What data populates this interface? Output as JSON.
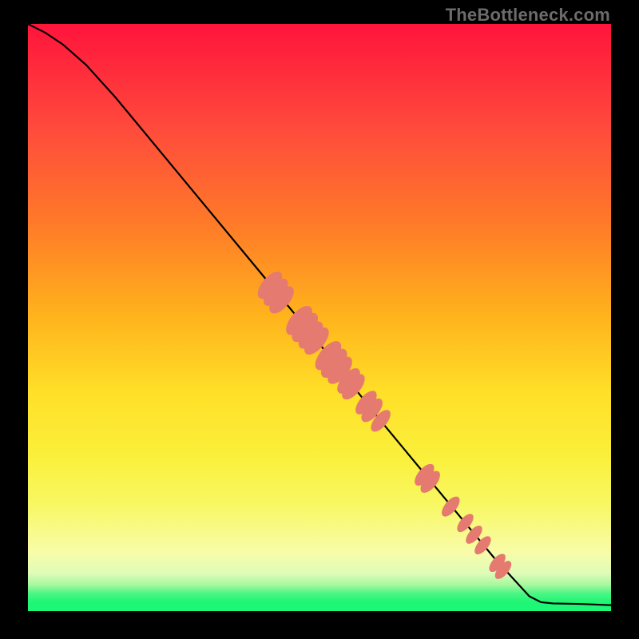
{
  "watermark": "TheBottleneck.com",
  "colors": {
    "gradient_top": "#ff143c",
    "gradient_mid_upper": "#ff7a28",
    "gradient_mid": "#ffe028",
    "gradient_lower": "#f8fca8",
    "gradient_bottom": "#1ef676",
    "frame": "#000000",
    "curve": "#000000",
    "points": "#e57a70"
  },
  "chart_data": {
    "type": "line",
    "title": "",
    "xlabel": "",
    "ylabel": "",
    "xlim": [
      0,
      100
    ],
    "ylim": [
      0,
      100
    ],
    "note": "Axes are unlabeled; values are estimated on a 0–100 grid from the plot geometry. Large y = top (red), small y = bottom (green).",
    "curve": [
      {
        "x": 0.0,
        "y": 100.0
      },
      {
        "x": 3.0,
        "y": 98.5
      },
      {
        "x": 6.0,
        "y": 96.5
      },
      {
        "x": 10.0,
        "y": 93.0
      },
      {
        "x": 15.0,
        "y": 87.5
      },
      {
        "x": 20.0,
        "y": 81.5
      },
      {
        "x": 30.0,
        "y": 69.5
      },
      {
        "x": 40.0,
        "y": 57.5
      },
      {
        "x": 50.0,
        "y": 45.5
      },
      {
        "x": 60.0,
        "y": 33.0
      },
      {
        "x": 70.0,
        "y": 21.0
      },
      {
        "x": 80.0,
        "y": 9.0
      },
      {
        "x": 86.0,
        "y": 2.5
      },
      {
        "x": 88.0,
        "y": 1.5
      },
      {
        "x": 90.0,
        "y": 1.3
      },
      {
        "x": 95.0,
        "y": 1.2
      },
      {
        "x": 100.0,
        "y": 1.0
      }
    ],
    "points_cluster_1": [
      {
        "x": 41.5,
        "y": 55.5,
        "w": 3.0
      },
      {
        "x": 42.5,
        "y": 54.3,
        "w": 3.0
      },
      {
        "x": 43.5,
        "y": 53.0,
        "w": 3.0
      },
      {
        "x": 46.5,
        "y": 49.5,
        "w": 3.2
      },
      {
        "x": 47.5,
        "y": 48.3,
        "w": 3.2
      },
      {
        "x": 48.5,
        "y": 47.0,
        "w": 3.0
      },
      {
        "x": 49.5,
        "y": 46.0,
        "w": 3.0
      },
      {
        "x": 51.5,
        "y": 43.5,
        "w": 3.2
      },
      {
        "x": 52.5,
        "y": 42.2,
        "w": 3.2
      },
      {
        "x": 53.5,
        "y": 41.0,
        "w": 3.0
      },
      {
        "x": 55.0,
        "y": 39.2,
        "w": 2.8
      },
      {
        "x": 55.8,
        "y": 38.2,
        "w": 2.8
      },
      {
        "x": 58.0,
        "y": 35.5,
        "w": 2.6
      },
      {
        "x": 59.0,
        "y": 34.2,
        "w": 2.6
      },
      {
        "x": 60.5,
        "y": 32.4,
        "w": 2.4
      }
    ],
    "points_cluster_2": [
      {
        "x": 68.0,
        "y": 23.2,
        "w": 2.4
      },
      {
        "x": 69.0,
        "y": 22.0,
        "w": 2.4
      },
      {
        "x": 72.5,
        "y": 17.8,
        "w": 2.2
      },
      {
        "x": 75.0,
        "y": 15.0,
        "w": 2.0
      },
      {
        "x": 76.5,
        "y": 13.0,
        "w": 2.0
      },
      {
        "x": 78.0,
        "y": 11.2,
        "w": 2.0
      },
      {
        "x": 80.5,
        "y": 8.2,
        "w": 2.0
      },
      {
        "x": 81.5,
        "y": 7.0,
        "w": 2.0
      }
    ]
  }
}
